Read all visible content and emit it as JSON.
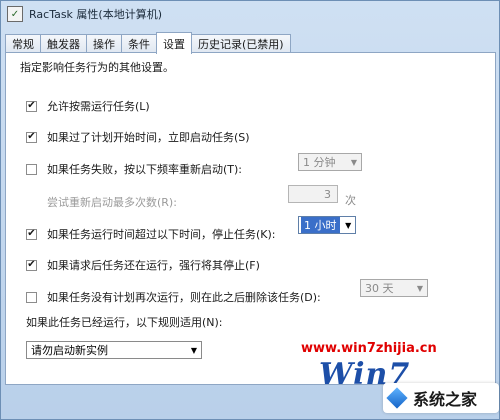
{
  "window": {
    "title": "RacTask 属性(本地计算机)"
  },
  "tabs": [
    {
      "label": "常规"
    },
    {
      "label": "触发器"
    },
    {
      "label": "操作"
    },
    {
      "label": "条件"
    },
    {
      "label": "设置",
      "active": true
    },
    {
      "label": "历史记录(已禁用)"
    }
  ],
  "settings": {
    "description": "指定影响任务行为的其他设置。",
    "allow_on_demand": {
      "label": "允许按需运行任务(L)",
      "checked": true
    },
    "run_asap": {
      "label": "如果过了计划开始时间，立即启动任务(S)",
      "checked": true
    },
    "restart_on_fail": {
      "label": "如果任务失败，按以下频率重新启动(T):",
      "checked": false,
      "interval_value": "1 分钟"
    },
    "restart_attempts": {
      "label": "尝试重新启动最多次数(R):",
      "value": "3",
      "unit": "次"
    },
    "stop_if_long": {
      "label": "如果任务运行时间超过以下时间，停止任务(K):",
      "checked": true,
      "duration_value": "1 小时"
    },
    "force_stop": {
      "label": "如果请求后任务还在运行，强行将其停止(F)",
      "checked": true
    },
    "delete_if_not_scheduled": {
      "label": "如果任务没有计划再次运行，则在此之后删除该任务(D):",
      "checked": false,
      "after_value": "30 天"
    },
    "already_running": {
      "label": "如果此任务已经运行，以下规则适用(N):",
      "value": "请勿启动新实例"
    }
  },
  "watermark": {
    "site": "www.win7zhijia.cn",
    "logo_text": "Win7",
    "brand": "系统之家"
  },
  "colors": {
    "accent": "#3a6fc9",
    "watermark_red": "#e00000"
  }
}
